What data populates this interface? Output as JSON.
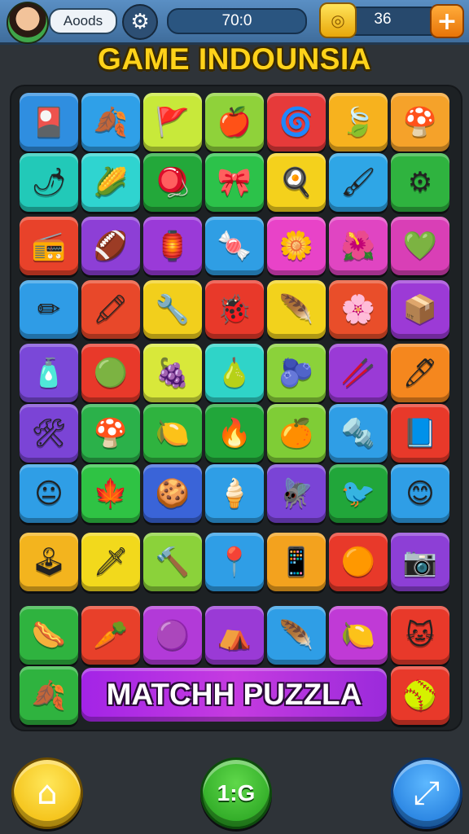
{
  "header": {
    "player_name": "Aoods",
    "timer": "70:0",
    "coins": "36",
    "add_label": "+",
    "settings_icon": "gear-icon",
    "coin_icon": "coin-icon"
  },
  "title": "GAME INDOUNSIA",
  "banner": "MATCHH PUZZLA",
  "bottom": {
    "home_icon": "home-icon",
    "center_label": "1:G",
    "share_icon": "share-icon"
  },
  "board": {
    "rows": [
      [
        {
          "color": "#2f8ee0",
          "icon": "cards-icon",
          "glyph": "🎴"
        },
        {
          "color": "#2fa0e8",
          "icon": "leaf-red-icon",
          "glyph": "🍂"
        },
        {
          "color": "#c8e93a",
          "icon": "flag-icon",
          "glyph": "🚩"
        },
        {
          "color": "#8fd23a",
          "icon": "apple-icon",
          "glyph": "🍎"
        },
        {
          "color": "#e63a3a",
          "icon": "swirl-icon",
          "glyph": "🌀"
        },
        {
          "color": "#f7b21e",
          "icon": "leaf-icon",
          "glyph": "🍃"
        },
        {
          "color": "#f5a22a",
          "icon": "mushroom-icon",
          "glyph": "🍄"
        }
      ],
      [
        {
          "color": "#22c9b8",
          "icon": "chili-icon",
          "glyph": "🌶"
        },
        {
          "color": "#2fd4d0",
          "icon": "corn-icon",
          "glyph": "🌽"
        },
        {
          "color": "#23a83a",
          "icon": "spinning-top-icon",
          "glyph": "🪀"
        },
        {
          "color": "#2cc24a",
          "icon": "ribbon-icon",
          "glyph": "🎀"
        },
        {
          "color": "#f4d11c",
          "icon": "spatula-icon",
          "glyph": "🍳"
        },
        {
          "color": "#2fa6e6",
          "icon": "brush-icon",
          "glyph": "🖌"
        },
        {
          "color": "#2fb33f",
          "icon": "gear-ball-icon",
          "glyph": "⚙"
        }
      ],
      [
        {
          "color": "#e8422a",
          "icon": "radio-icon",
          "glyph": "📻"
        },
        {
          "color": "#8d3fd6",
          "icon": "ball-icon",
          "glyph": "🏈"
        },
        {
          "color": "#9a3ad8",
          "icon": "lantern-icon",
          "glyph": "🏮"
        },
        {
          "color": "#2f9ee4",
          "icon": "candy-icon",
          "glyph": "🍬"
        },
        {
          "color": "#e843c8",
          "icon": "flower-blue-icon",
          "glyph": "🌼"
        },
        {
          "color": "#e045c2",
          "icon": "flower-icon",
          "glyph": "🌺"
        },
        {
          "color": "#d93fb6",
          "icon": "heart-leaf-icon",
          "glyph": "💚"
        }
      ],
      [
        {
          "color": "#2f9ce6",
          "icon": "pencil-icon",
          "glyph": "✏"
        },
        {
          "color": "#e8482a",
          "icon": "crayon-icon",
          "glyph": "🖍"
        },
        {
          "color": "#f2cf1c",
          "icon": "tool-icon",
          "glyph": "🔧"
        },
        {
          "color": "#e8392a",
          "icon": "bug-icon",
          "glyph": "🐞"
        },
        {
          "color": "#f2d21c",
          "icon": "feather-icon",
          "glyph": "🪶"
        },
        {
          "color": "#e94e2a",
          "icon": "flower-red-icon",
          "glyph": "🌸"
        },
        {
          "color": "#9c3ad6",
          "icon": "box-icon",
          "glyph": "📦"
        }
      ],
      [
        {
          "color": "#7a48d8",
          "icon": "bottle-icon",
          "glyph": "🧴"
        },
        {
          "color": "#e8392a",
          "icon": "face-green-icon",
          "glyph": "🟢"
        },
        {
          "color": "#d8e83a",
          "icon": "berry-icon",
          "glyph": "🍇"
        },
        {
          "color": "#2fd4c8",
          "icon": "leaf-face-icon",
          "glyph": "🍐"
        },
        {
          "color": "#8bd23a",
          "icon": "fruit-blue-icon",
          "glyph": "🫐"
        },
        {
          "color": "#9a3ad6",
          "icon": "stick-icon",
          "glyph": "🥢"
        },
        {
          "color": "#f5871e",
          "icon": "pen-icon",
          "glyph": "🖊"
        }
      ],
      [
        {
          "color": "#7b44d6",
          "icon": "tools-icon",
          "glyph": "🛠"
        },
        {
          "color": "#2bb14a",
          "icon": "mushroom-face-icon",
          "glyph": "🍄"
        },
        {
          "color": "#2fb33f",
          "icon": "lemon-face-icon",
          "glyph": "🍋"
        },
        {
          "color": "#21a63a",
          "icon": "fire-icon",
          "glyph": "🔥"
        },
        {
          "color": "#7fcd36",
          "icon": "orange-icon",
          "glyph": "🍊"
        },
        {
          "color": "#2f9ee6",
          "icon": "wrench-icon",
          "glyph": "🔩"
        },
        {
          "color": "#e8392a",
          "icon": "book-icon",
          "glyph": "📘"
        }
      ],
      [
        {
          "color": "#2f9ee6",
          "icon": "smiley-icon",
          "glyph": "😐"
        },
        {
          "color": "#2fc344",
          "icon": "maple-icon",
          "glyph": "🍁"
        },
        {
          "color": "#3a64d8",
          "icon": "cookie-icon",
          "glyph": "🍪"
        },
        {
          "color": "#2f9ee6",
          "icon": "ice-cream-icon",
          "glyph": "🍦"
        },
        {
          "color": "#7a44d6",
          "icon": "dragonfly-icon",
          "glyph": "🪰"
        },
        {
          "color": "#21a63a",
          "icon": "bird-icon",
          "glyph": "🐦"
        },
        {
          "color": "#2f9ee6",
          "icon": "smiley-blue-icon",
          "glyph": "😊"
        }
      ],
      [
        {
          "color": "#f3b41e",
          "icon": "arcade-icon",
          "glyph": "🕹"
        },
        {
          "color": "#f2d91c",
          "icon": "knife-icon",
          "glyph": "🗡"
        },
        {
          "color": "#8bd23a",
          "icon": "hammer-icon",
          "glyph": "🔨"
        },
        {
          "color": "#2f9ee6",
          "icon": "compass-icon",
          "glyph": "📍"
        },
        {
          "color": "#f3a21e",
          "icon": "phone-icon",
          "glyph": "📱"
        },
        {
          "color": "#e8392a",
          "icon": "orb-icon",
          "glyph": "🟠"
        },
        {
          "color": "#8d3fd6",
          "icon": "camera-icon",
          "glyph": "📷"
        }
      ],
      [
        {
          "color": "#2fb33f",
          "icon": "stick-brown-icon",
          "glyph": "🌭"
        },
        {
          "color": "#e8402a",
          "icon": "carrot-icon",
          "glyph": "🥕"
        },
        {
          "color": "#b23ad8",
          "icon": "gem-icon",
          "glyph": "🟣"
        },
        {
          "color": "#9a3ad6",
          "icon": "tent-icon",
          "glyph": "⛺"
        },
        {
          "color": "#2f9ee6",
          "icon": "feather-white-icon",
          "glyph": "🪶"
        },
        {
          "color": "#c03ad6",
          "icon": "lemon-icon",
          "glyph": "🍋"
        },
        {
          "color": "#e8392a",
          "icon": "cat-face-icon",
          "glyph": "🐱"
        }
      ],
      [
        {
          "color": "#2fb33f",
          "icon": "leaf-red-small-icon",
          "glyph": "🍂"
        },
        {
          "color": "#d83ad2",
          "icon": "",
          "glyph": ""
        },
        {
          "color": "#b03ad6",
          "icon": "",
          "glyph": ""
        },
        {
          "color": "#a63ad6",
          "icon": "",
          "glyph": ""
        },
        {
          "color": "#3a88e6",
          "icon": "",
          "glyph": ""
        },
        {
          "color": "#b03ad6",
          "icon": "",
          "glyph": ""
        },
        {
          "color": "#e8392a",
          "icon": "ball-yellow-icon",
          "glyph": "🥎"
        }
      ]
    ]
  }
}
